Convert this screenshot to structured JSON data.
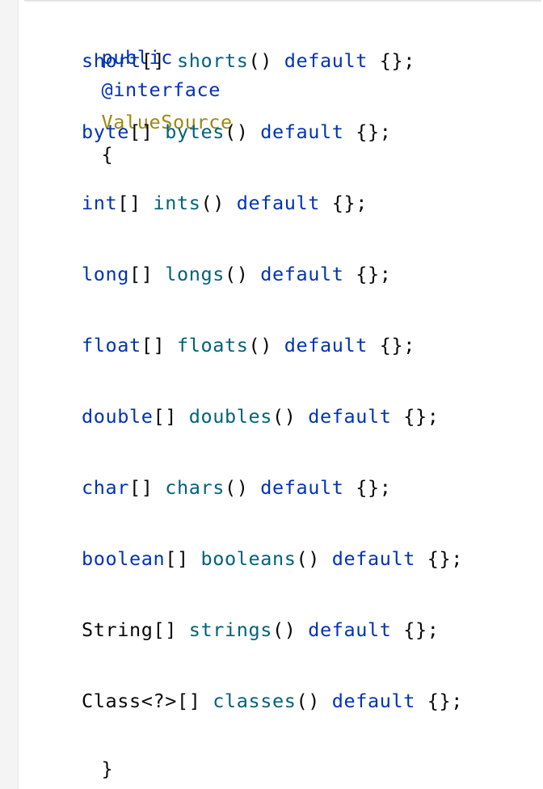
{
  "declaration": {
    "modifier": "public",
    "annotation_keyword": "@interface",
    "type_name": "ValueSource",
    "open_brace": "{",
    "close_brace": "}"
  },
  "members": [
    {
      "type": "short",
      "type_suffix": "[]",
      "name": "shorts",
      "parens": "()",
      "default_keyword": "default",
      "value": "{};"
    },
    {
      "type": "byte",
      "type_suffix": "[]",
      "name": "bytes",
      "parens": "()",
      "default_keyword": "default",
      "value": "{};"
    },
    {
      "type": "int",
      "type_suffix": "[]",
      "name": "ints",
      "parens": "()",
      "default_keyword": "default",
      "value": "{};"
    },
    {
      "type": "long",
      "type_suffix": "[]",
      "name": "longs",
      "parens": "()",
      "default_keyword": "default",
      "value": "{};"
    },
    {
      "type": "float",
      "type_suffix": "[]",
      "name": "floats",
      "parens": "()",
      "default_keyword": "default",
      "value": "{};"
    },
    {
      "type": "double",
      "type_suffix": "[]",
      "name": "doubles",
      "parens": "()",
      "default_keyword": "default",
      "value": "{};"
    },
    {
      "type": "char",
      "type_suffix": "[]",
      "name": "chars",
      "parens": "()",
      "default_keyword": "default",
      "value": "{};"
    },
    {
      "type": "boolean",
      "type_suffix": "[]",
      "name": "booleans",
      "parens": "()",
      "default_keyword": "default",
      "value": "{};"
    },
    {
      "type": "String",
      "type_suffix": "[]",
      "name": "strings",
      "parens": "()",
      "default_keyword": "default",
      "value": "{};"
    },
    {
      "type": "Class",
      "type_suffix": "<?>[]",
      "name": "classes",
      "parens": "()",
      "default_keyword": "default",
      "value": "{};"
    }
  ],
  "colors": {
    "keyword": "#0033b3",
    "annotation_type": "#9e880d",
    "method_name": "#00627a",
    "plain_text": "#080808",
    "background": "#ffffff",
    "gutter": "#f4f4f4"
  }
}
